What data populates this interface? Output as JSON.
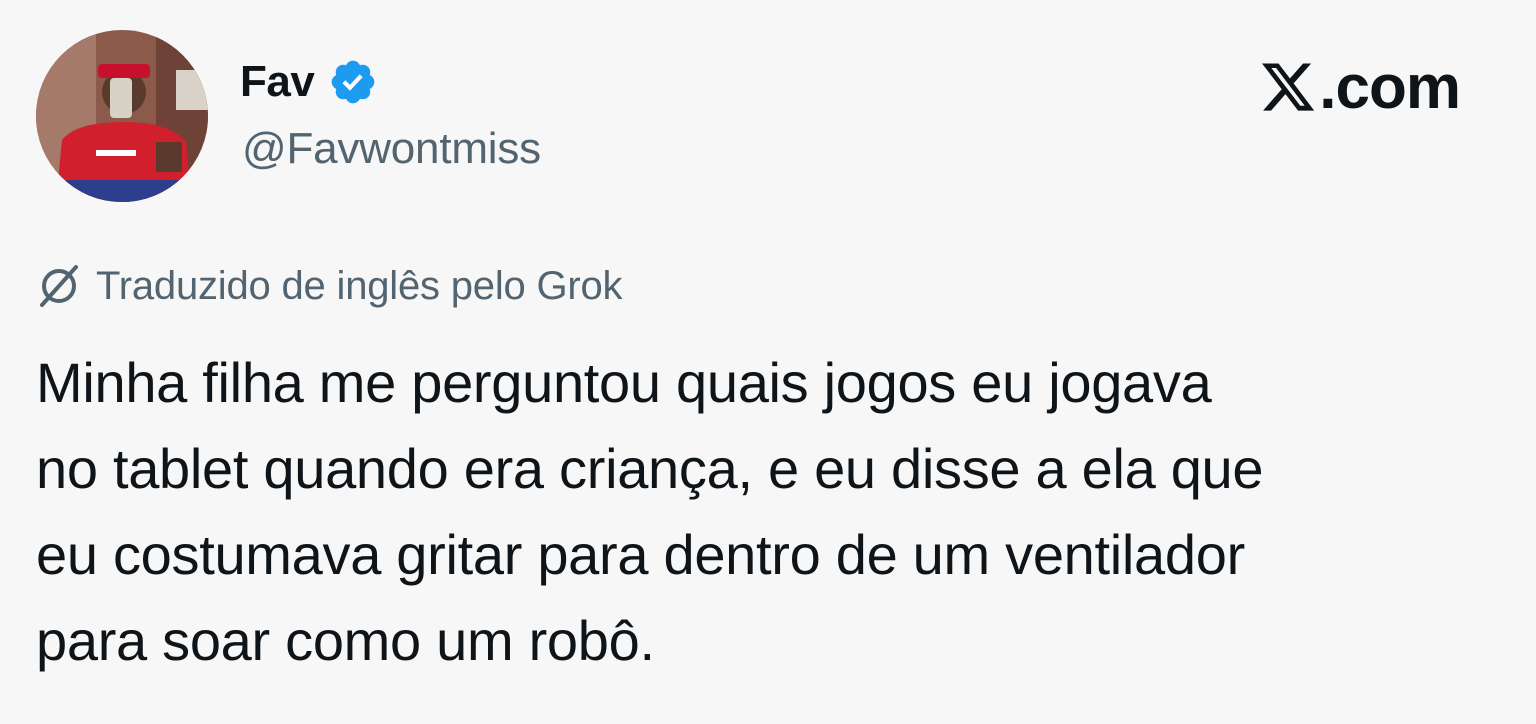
{
  "author": {
    "name": "Fav",
    "handle": "@Favwontmiss",
    "verified": true,
    "verified_icon": "verified-badge-icon",
    "avatar": "profile-photo-avatar"
  },
  "brand": {
    "logo_icon": "x-logo-icon",
    "domain": ".com"
  },
  "translation": {
    "icon": "grok-icon",
    "label": "Traduzido de inglês pelo Grok"
  },
  "tweet": {
    "lines": [
      "Minha filha me perguntou quais jogos eu jogava",
      "no tablet quando era criança, e eu disse a ela que",
      "eu costumava gritar para dentro de um ventilador",
      "para soar como um robô."
    ]
  },
  "colors": {
    "verified_blue": "#1d9bf0",
    "text_primary": "#0f1419",
    "text_secondary": "#536471",
    "background": "#f7f7f7"
  }
}
